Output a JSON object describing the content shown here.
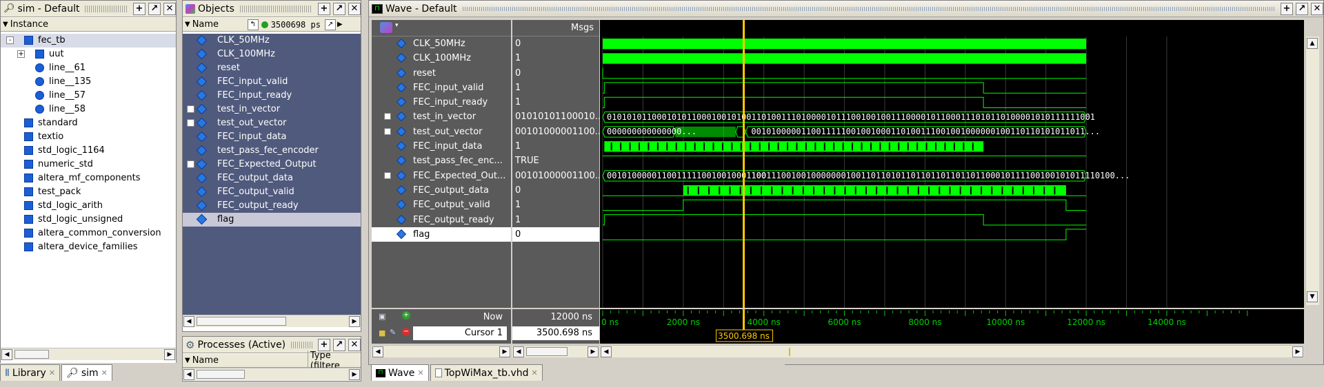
{
  "sim_pane": {
    "title": "sim - Default",
    "column_header": "Instance",
    "items": [
      {
        "label": "fec_tb",
        "icon": "module-icon",
        "expand": "-"
      },
      {
        "label": "uut",
        "icon": "module-icon",
        "expand": "+"
      },
      {
        "label": "line__61",
        "icon": "process-icon"
      },
      {
        "label": "line__135",
        "icon": "process-icon"
      },
      {
        "label": "line__57",
        "icon": "process-icon"
      },
      {
        "label": "line__58",
        "icon": "process-icon"
      },
      {
        "label": "standard",
        "icon": "package-icon"
      },
      {
        "label": "textio",
        "icon": "package-icon"
      },
      {
        "label": "std_logic_1164",
        "icon": "package-icon"
      },
      {
        "label": "numeric_std",
        "icon": "package-icon"
      },
      {
        "label": "altera_mf_components",
        "icon": "package-icon"
      },
      {
        "label": "test_pack",
        "icon": "package-icon"
      },
      {
        "label": "std_logic_arith",
        "icon": "package-icon"
      },
      {
        "label": "std_logic_unsigned",
        "icon": "package-icon"
      },
      {
        "label": "altera_common_conversion",
        "icon": "package-icon"
      },
      {
        "label": "altera_device_families",
        "icon": "package-icon"
      }
    ],
    "tabs": [
      {
        "label": "Library"
      },
      {
        "label": "sim"
      }
    ]
  },
  "objects_pane": {
    "title": "Objects",
    "column_header": "Name",
    "time_value": "3500698 ps",
    "items": [
      {
        "label": "CLK_50MHz",
        "expand": ""
      },
      {
        "label": "CLK_100MHz",
        "expand": ""
      },
      {
        "label": "reset",
        "expand": ""
      },
      {
        "label": "FEC_input_valid",
        "expand": ""
      },
      {
        "label": "FEC_input_ready",
        "expand": ""
      },
      {
        "label": "test_in_vector",
        "expand": "+"
      },
      {
        "label": "test_out_vector",
        "expand": "+"
      },
      {
        "label": "FEC_input_data",
        "expand": ""
      },
      {
        "label": "test_pass_fec_encoder",
        "expand": ""
      },
      {
        "label": "FEC_Expected_Output",
        "expand": "+"
      },
      {
        "label": "FEC_output_data",
        "expand": ""
      },
      {
        "label": "FEC_output_valid",
        "expand": ""
      },
      {
        "label": "FEC_output_ready",
        "expand": ""
      },
      {
        "label": "flag",
        "expand": ""
      }
    ]
  },
  "processes_pane": {
    "title": "Processes (Active)",
    "col_name": "Name",
    "col_type": "Type (filtere"
  },
  "wave_pane": {
    "title": "Wave - Default",
    "msgs_header": "Msgs",
    "signals": [
      {
        "name": "CLK_50MHz",
        "value": "0",
        "expand": ""
      },
      {
        "name": "CLK_100MHz",
        "value": "1",
        "expand": ""
      },
      {
        "name": "reset",
        "value": "0",
        "expand": ""
      },
      {
        "name": "FEC_input_valid",
        "value": "1",
        "expand": ""
      },
      {
        "name": "FEC_input_ready",
        "value": "1",
        "expand": ""
      },
      {
        "name": "test_in_vector",
        "value": "01010101100010...",
        "expand": "+"
      },
      {
        "name": "test_out_vector",
        "value": "00101000001100...",
        "expand": "+"
      },
      {
        "name": "FEC_input_data",
        "value": "1",
        "expand": ""
      },
      {
        "name": "test_pass_fec_enc...",
        "value": "TRUE",
        "expand": ""
      },
      {
        "name": "FEC_Expected_Out...",
        "value": "00101000001100...",
        "expand": "+"
      },
      {
        "name": "FEC_output_data",
        "value": "0",
        "expand": ""
      },
      {
        "name": "FEC_output_valid",
        "value": "1",
        "expand": ""
      },
      {
        "name": "FEC_output_ready",
        "value": "1",
        "expand": ""
      },
      {
        "name": "flag",
        "value": "0",
        "expand": ""
      }
    ],
    "bus_labels": {
      "test_in_vector": "01010101100010101100010010100110100111010000101110010010011100001011000111010110100001010111111001",
      "test_out_vector_a": "000000000000000...",
      "test_out_vector_b": "0010100000110011111001001000110100111001001000000100110110101011011...",
      "expected_a": "00101000001100111110010010001100",
      "expected_b": "1001110010010000000100110110101101101101101101100010111100100101011110100..."
    },
    "now_label": "Now",
    "now_value": "12000 ns",
    "cursor_label": "Cursor 1",
    "cursor_value": "3500.698 ns",
    "cursor_flag": "3500.698 ns",
    "ruler": [
      "0 ns",
      "2000 ns",
      "4000 ns",
      "6000 ns",
      "8000 ns",
      "10000 ns",
      "12000 ns",
      "14000 ns"
    ],
    "tabs": [
      {
        "label": "Wave"
      },
      {
        "label": "TopWiMax_tb.vhd"
      }
    ],
    "colors": {
      "wave": "#00ff00",
      "cursor": "#ffcc00",
      "bg": "#000000",
      "panel": "#5a5a5a"
    }
  }
}
